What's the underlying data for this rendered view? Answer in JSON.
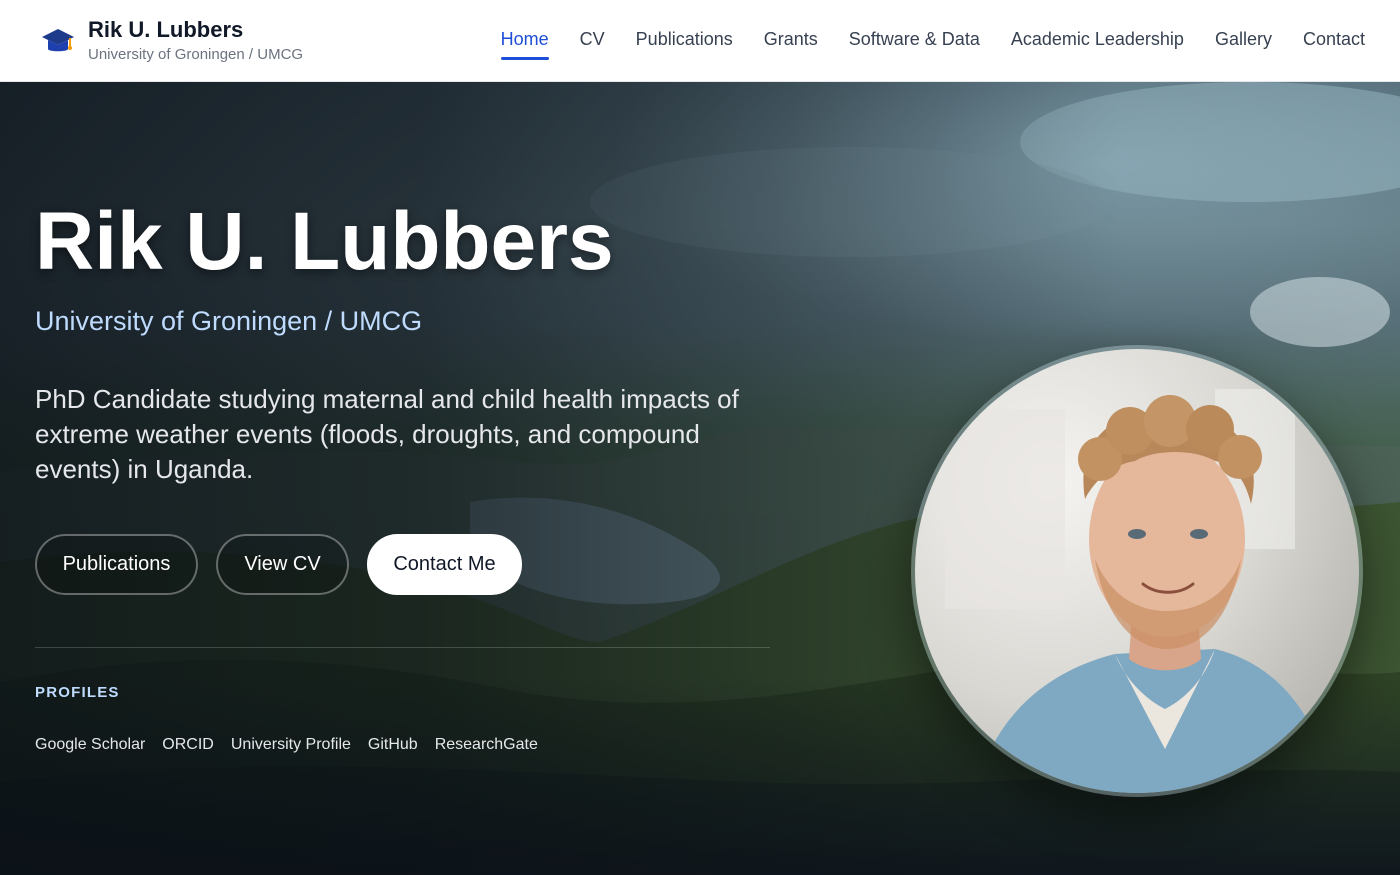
{
  "header": {
    "brand_name": "Rik U. Lubbers",
    "brand_subtitle": "University of Groningen / UMCG",
    "logo_icon": "graduation-cap-icon",
    "accent_color": "#1d4ed8",
    "nav": [
      {
        "label": "Home",
        "active": true
      },
      {
        "label": "CV"
      },
      {
        "label": "Publications"
      },
      {
        "label": "Grants"
      },
      {
        "label": "Software & Data"
      },
      {
        "label": "Academic Leadership"
      },
      {
        "label": "Gallery"
      },
      {
        "label": "Contact"
      }
    ]
  },
  "hero": {
    "title": "Rik U. Lubbers",
    "affiliation": "University of Groningen / UMCG",
    "description": "PhD Candidate studying maternal and child health impacts of extreme weather events (floods, droughts, and compound events) in Uganda.",
    "buttons": {
      "publications": "Publications",
      "view_cv": "View CV",
      "contact": "Contact Me"
    },
    "profiles_heading": "PROFILES",
    "profiles": [
      "Google Scholar",
      "ORCID",
      "University Profile",
      "GitHub",
      "ResearchGate"
    ]
  }
}
